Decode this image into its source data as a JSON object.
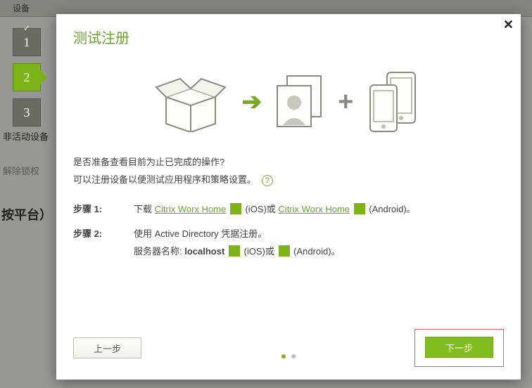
{
  "backdrop": {
    "tab": "设备",
    "row1": "非活动设备",
    "row2": "解除锁权",
    "heading": "按平台）"
  },
  "wizard": {
    "steps": [
      "1",
      "2",
      "3"
    ],
    "active_index": 1
  },
  "modal": {
    "title": "测试注册",
    "close_label": "✕"
  },
  "illustration": {
    "arrow": "➔",
    "plus": "+"
  },
  "body": {
    "q": "是否准备查看目前为止已完成的操作?",
    "p": "可以注册设备以便测试应用程序和策略设置。",
    "help": "?"
  },
  "table": {
    "step1": {
      "label": "步骤 1:",
      "prefix": "下载 ",
      "link_ios": "Citrix Worx Home",
      "mid": " (iOS)或 ",
      "link_android": "Citrix Worx Home",
      "suffix": " (Android)。"
    },
    "step2": {
      "label": "步骤 2:",
      "line1": "使用 Active Directory 凭据注册。",
      "line2_prefix": "服务器名称: ",
      "server": "localhost",
      "line2_mid": " (iOS)或 ",
      "line2_suffix": " (Android)。"
    }
  },
  "footer": {
    "back": "上一步",
    "next": "下一步"
  },
  "pager": {
    "total": 2,
    "current": 0
  }
}
